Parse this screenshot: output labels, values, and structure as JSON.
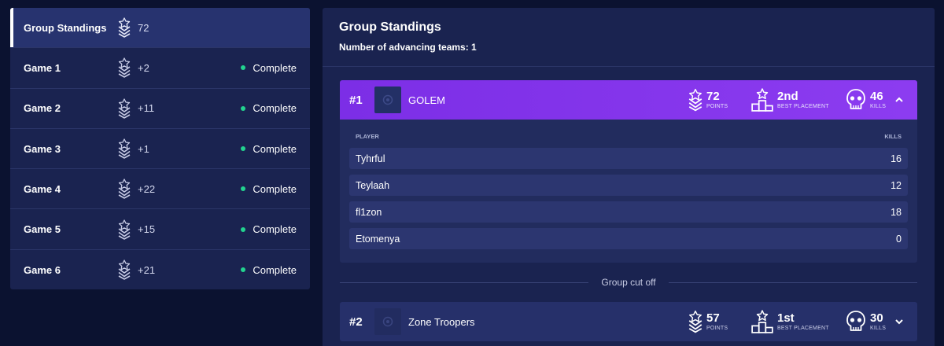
{
  "sidebar": {
    "items": [
      {
        "label": "Group Standings",
        "points": "72",
        "status": ""
      },
      {
        "label": "Game 1",
        "points": "+2",
        "status": "Complete"
      },
      {
        "label": "Game 2",
        "points": "+11",
        "status": "Complete"
      },
      {
        "label": "Game 3",
        "points": "+1",
        "status": "Complete"
      },
      {
        "label": "Game 4",
        "points": "+22",
        "status": "Complete"
      },
      {
        "label": "Game 5",
        "points": "+15",
        "status": "Complete"
      },
      {
        "label": "Game 6",
        "points": "+21",
        "status": "Complete"
      }
    ]
  },
  "main": {
    "title": "Group Standings",
    "subtitle": "Number of advancing teams: 1",
    "cutoff_label": "Group cut off",
    "columns": {
      "player": "PLAYER",
      "kills": "KILLS"
    },
    "stat_captions": {
      "points": "POINTS",
      "placement": "BEST PLACEMENT",
      "kills": "KILLS"
    },
    "teams": [
      {
        "rank": "#1",
        "name": "GOLEM",
        "points": "72",
        "best_placement": "2nd",
        "kills": "46",
        "players": [
          {
            "name": "Tyhrful",
            "kills": "16"
          },
          {
            "name": "Teylaah",
            "kills": "12"
          },
          {
            "name": "fl1zon",
            "kills": "18"
          },
          {
            "name": "Etomenya",
            "kills": "0"
          }
        ]
      },
      {
        "rank": "#2",
        "name": "Zone Troopers",
        "points": "57",
        "best_placement": "1st",
        "kills": "30"
      }
    ]
  },
  "colors": {
    "background": "#0b1230",
    "panel": "#1a2350",
    "accent_purple": "#8c3cf0",
    "status_green": "#22d38f"
  },
  "icons": [
    "rank-chevron-icon",
    "trophy-stand-icon",
    "skull-icon",
    "chevron-up-icon",
    "chevron-down-icon",
    "team-logo-icon"
  ]
}
